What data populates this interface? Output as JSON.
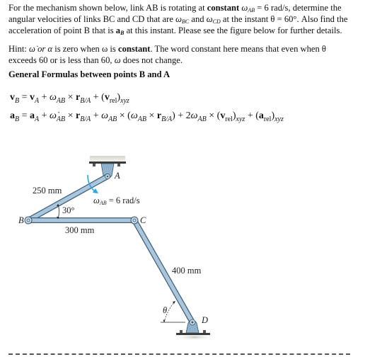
{
  "problem": {
    "line1_pre": "For the mechanism shown below, link AB is rotating at ",
    "line1_bold": "constant",
    "line1_omega": "ω",
    "line1_omega_sub": "AB",
    "line1_post": " = 6 rad/s, determine the",
    "line2_pre": "angular velocities of links BC and CD that are ",
    "line2_w1": "ω",
    "line2_w1_sub": "BC",
    "line2_mid": " and ",
    "line2_w2": "ω",
    "line2_w2_sub": "CD",
    "line2_post": " at the instant θ = 60°. Also find the",
    "line3_pre": "acceleration of point B that is ",
    "line3_bold": "a",
    "line3_bold_sub": "B",
    "line3_post": " at this instant. Please see the figure below for further details."
  },
  "hint": {
    "line1_pre": "Hint: ",
    "line1_symbols": "ω̇ or α",
    "line1_mid": " is zero when ω is ",
    "line1_bold": "constant",
    "line1_post": ". The word constant here means that even when θ",
    "line2_pre": "exceeds 60 or is less than 60, ",
    "line2_omega": "ω",
    "line2_post": " does not change."
  },
  "section_heading": "General Formulas between points B and A",
  "formulas": {
    "velocity": {
      "v": "v",
      "B": "B",
      "eq": " = ",
      "vA": "v",
      "A": "A",
      "plus1": " + ",
      "w": "ω",
      "AB": "AB",
      "cross": " × ",
      "r": "r",
      "BA": "B/A",
      "plus2": " + (",
      "vrel": "v",
      "rel": "rel",
      "close": ")",
      "xyz": "xyz"
    },
    "acceleration": {
      "a": "a",
      "B": "B",
      "eq": " = ",
      "aA": "a",
      "A": "A",
      "plus1": " + ",
      "wdot": "ω̇",
      "AB": "AB",
      "cross": " × ",
      "r": "r",
      "BA": "B/A",
      "plus2": " + ",
      "w": "ω",
      "open": " × (",
      "close": ")",
      "plus3": " + 2",
      "plus4": " × (",
      "vrel": "v",
      "rel": "rel",
      "xyz": "xyz",
      "plus5": " + (",
      "arel": "a"
    }
  },
  "figure": {
    "labels": {
      "A": "A",
      "B": "B",
      "C": "C",
      "D": "D",
      "AB_length": "250 mm",
      "BC_length": "300 mm",
      "CD_length": "400 mm",
      "angle_AB": "30°",
      "theta": "θ",
      "omega_label": "ω",
      "omega_sub": "AB",
      "omega_value": " = 6 rad/s"
    },
    "colors": {
      "link_fill": "#a9c6dc",
      "link_stroke": "#4d6f8c",
      "omega_arrow": "#2aa7e0",
      "support": "#8fb3cf"
    }
  }
}
